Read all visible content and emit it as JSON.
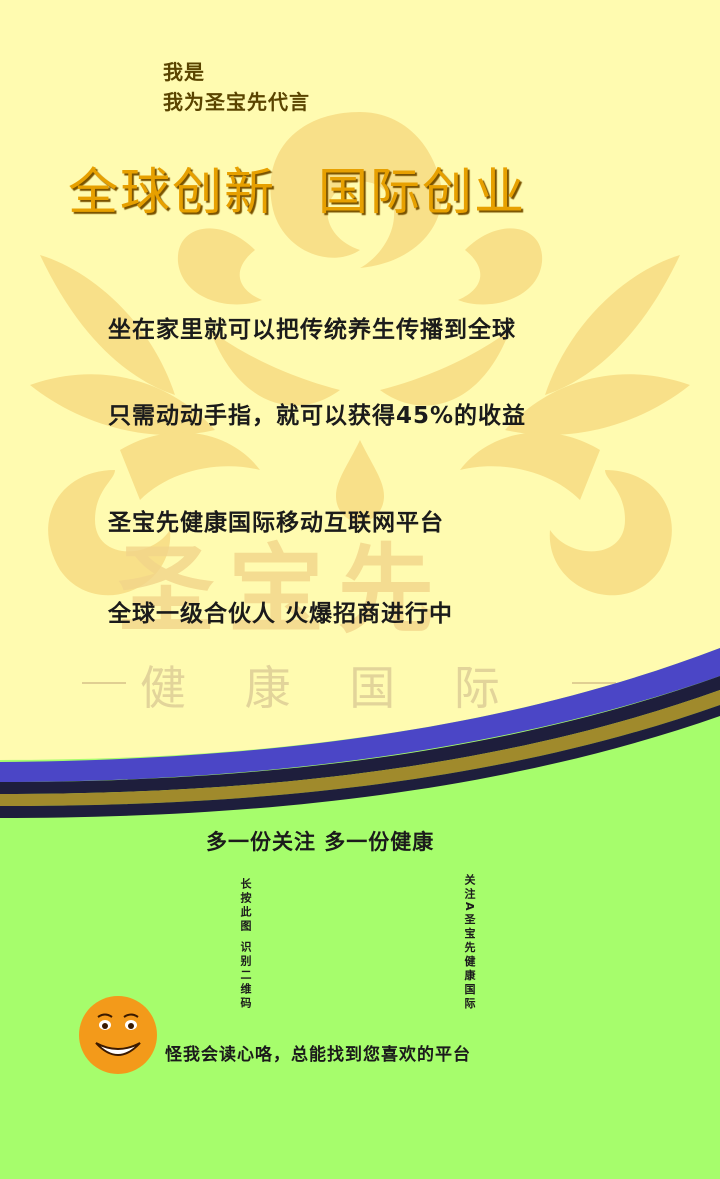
{
  "intro": {
    "line1": "我是",
    "line2": "我为圣宝先代言"
  },
  "headline": {
    "part1": "全球创新",
    "part2": "国际创业"
  },
  "lines": [
    "坐在家里就可以把传统养生传播到全球",
    "只需动动手指，就可以获得45%的收益",
    "圣宝先健康国际移动互联网平台",
    "全球一级合伙人 火爆招商进行中"
  ],
  "watermark": {
    "brand": "圣宝先",
    "subtitle": "健 康 国 际"
  },
  "slogan": "多一份关注 多一份健康",
  "qr_hint_left": "长按此图 识别二维码",
  "qr_hint_right": "关注A圣宝先健康国际",
  "footer": "怪我会读心咯，总能找到您喜欢的平台",
  "colors": {
    "top_background": "#fffbb0",
    "bottom_background": "#a6fd6c",
    "headline": "#e7a000",
    "stripe_blue": "#4b46c6",
    "stripe_olive": "#a08a2c",
    "stripe_navy": "#1e1e3c",
    "smiley": "#f39a1a"
  },
  "icons": [
    "lotus-logo-watermark",
    "smiley-face-icon"
  ]
}
